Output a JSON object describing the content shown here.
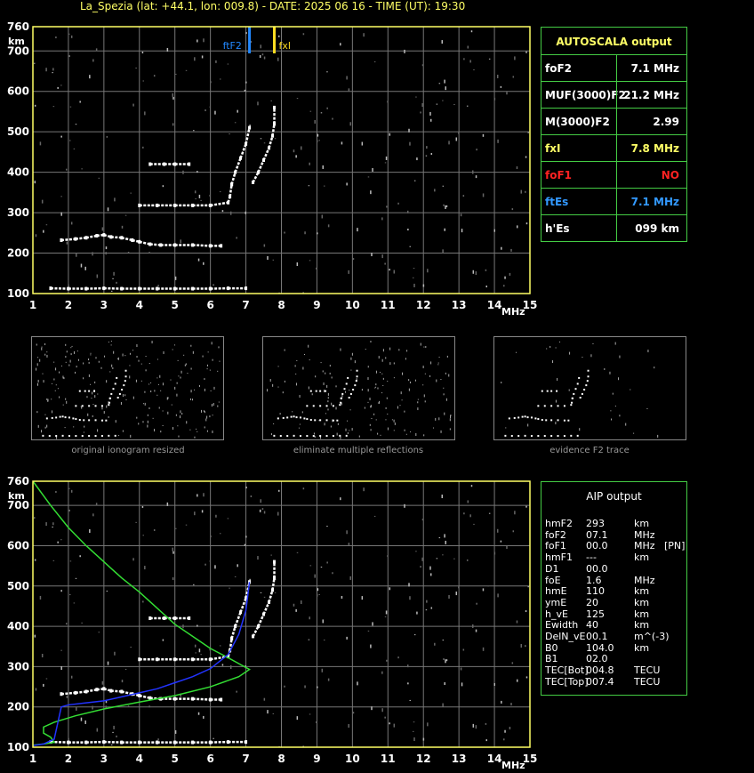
{
  "header": {
    "title": "La_Spezia (lat: +44.1, lon: 009.8) - DATE: 2025 06 16 - TIME (UT): 19:30"
  },
  "colors": {
    "axis": "#ffff66",
    "grid": "#777777",
    "trace": "#ffffff",
    "profile_green": "#33dd33",
    "profile_blue": "#2233ff",
    "fof2_marker": "#2288ff",
    "fxl_marker": "#ffdd22",
    "box": "#44cc44",
    "red": "#ff2222",
    "blue_text": "#3399ff",
    "yellow_text": "#ffff66"
  },
  "chart_data": [
    {
      "type": "scatter",
      "title": "",
      "xlabel": "MHz",
      "ylabel": "km",
      "xlim": [
        1,
        15
      ],
      "ylim": [
        100,
        760
      ],
      "x_ticks": [
        "1",
        "2",
        "3",
        "4",
        "5",
        "6",
        "7",
        "8",
        "9",
        "10",
        "11",
        "12",
        "13",
        "14",
        "15"
      ],
      "y_ticks": [
        "100",
        "200",
        "300",
        "400",
        "500",
        "600",
        "700",
        "760"
      ],
      "grid": true,
      "markers": [
        {
          "name": "foF2",
          "x": 7.1
        },
        {
          "name": "fxl",
          "x": 7.8
        }
      ],
      "series": [
        {
          "points": [
            [
              1.5,
              113
            ],
            [
              2.0,
              112
            ],
            [
              2.5,
              112
            ],
            [
              3.0,
              113
            ],
            [
              3.5,
              112
            ],
            [
              4.0,
              112
            ],
            [
              4.5,
              112
            ],
            [
              5.0,
              112
            ],
            [
              5.5,
              112
            ],
            [
              6.0,
              112
            ],
            [
              6.5,
              113
            ],
            [
              7.0,
              113
            ]
          ]
        },
        {
          "points": [
            [
              1.8,
              232
            ],
            [
              2.2,
              235
            ],
            [
              2.5,
              238
            ],
            [
              2.8,
              243
            ],
            [
              3.0,
              245
            ],
            [
              3.2,
              240
            ],
            [
              3.5,
              238
            ],
            [
              3.8,
              232
            ],
            [
              4.0,
              228
            ],
            [
              4.3,
              222
            ],
            [
              4.6,
              220
            ],
            [
              5.0,
              220
            ],
            [
              5.5,
              220
            ],
            [
              6.0,
              218
            ],
            [
              6.3,
              218
            ]
          ]
        },
        {
          "points": [
            [
              4.0,
              318
            ],
            [
              4.5,
              318
            ],
            [
              5.0,
              318
            ],
            [
              5.5,
              318
            ],
            [
              6.0,
              318
            ],
            [
              6.5,
              325
            ],
            [
              6.55,
              340
            ],
            [
              6.6,
              370
            ]
          ]
        },
        {
          "points": [
            [
              4.3,
              420
            ],
            [
              4.7,
              420
            ],
            [
              5.0,
              420
            ],
            [
              5.4,
              420
            ]
          ]
        },
        {
          "points": [
            [
              6.6,
              370
            ],
            [
              6.7,
              400
            ],
            [
              6.85,
              435
            ],
            [
              7.0,
              470
            ],
            [
              7.1,
              510
            ]
          ]
        },
        {
          "points": [
            [
              7.2,
              375
            ],
            [
              7.35,
              400
            ],
            [
              7.5,
              430
            ],
            [
              7.65,
              460
            ],
            [
              7.75,
              490
            ],
            [
              7.8,
              520
            ],
            [
              7.8,
              560
            ]
          ]
        }
      ]
    },
    {
      "type": "line",
      "title": "",
      "xlabel": "MHz",
      "ylabel": "km",
      "xlim": [
        1,
        15
      ],
      "ylim": [
        100,
        760
      ],
      "x_ticks": [
        "1",
        "2",
        "3",
        "4",
        "5",
        "6",
        "7",
        "8",
        "9",
        "10",
        "11",
        "12",
        "13",
        "14",
        "15"
      ],
      "y_ticks": [
        "100",
        "200",
        "300",
        "400",
        "500",
        "600",
        "700",
        "760"
      ],
      "grid": true,
      "series": [
        {
          "points": [
            [
              1.5,
              113
            ],
            [
              2.0,
              112
            ],
            [
              2.5,
              112
            ],
            [
              3.0,
              113
            ],
            [
              3.5,
              112
            ],
            [
              4.0,
              112
            ],
            [
              4.5,
              112
            ],
            [
              5.0,
              112
            ],
            [
              5.5,
              112
            ],
            [
              6.0,
              112
            ],
            [
              6.5,
              113
            ],
            [
              7.0,
              113
            ]
          ]
        },
        {
          "points": [
            [
              1.8,
              232
            ],
            [
              2.2,
              235
            ],
            [
              2.5,
              238
            ],
            [
              2.8,
              243
            ],
            [
              3.0,
              245
            ],
            [
              3.2,
              240
            ],
            [
              3.5,
              238
            ],
            [
              3.8,
              232
            ],
            [
              4.0,
              228
            ],
            [
              4.3,
              222
            ],
            [
              4.6,
              220
            ],
            [
              5.0,
              220
            ],
            [
              5.5,
              220
            ],
            [
              6.0,
              218
            ],
            [
              6.3,
              218
            ]
          ]
        },
        {
          "points": [
            [
              4.0,
              318
            ],
            [
              4.5,
              318
            ],
            [
              5.0,
              318
            ],
            [
              5.5,
              318
            ],
            [
              6.0,
              318
            ],
            [
              6.5,
              325
            ],
            [
              6.55,
              340
            ],
            [
              6.6,
              370
            ]
          ]
        },
        {
          "points": [
            [
              4.3,
              420
            ],
            [
              4.7,
              420
            ],
            [
              5.0,
              420
            ],
            [
              5.4,
              420
            ]
          ]
        },
        {
          "points": [
            [
              6.6,
              370
            ],
            [
              6.7,
              400
            ],
            [
              6.85,
              435
            ],
            [
              7.0,
              470
            ],
            [
              7.1,
              510
            ]
          ]
        },
        {
          "points": [
            [
              7.2,
              375
            ],
            [
              7.35,
              400
            ],
            [
              7.5,
              430
            ],
            [
              7.65,
              460
            ],
            [
              7.75,
              490
            ],
            [
              7.8,
              520
            ],
            [
              7.8,
              560
            ]
          ]
        },
        {
          "points": [
            [
              1.0,
              760
            ],
            [
              1.5,
              700
            ],
            [
              2.0,
              645
            ],
            [
              2.5,
              600
            ],
            [
              3.0,
              560
            ],
            [
              3.5,
              520
            ],
            [
              4.0,
              485
            ],
            [
              4.5,
              445
            ],
            [
              5.0,
              405
            ],
            [
              5.5,
              375
            ],
            [
              6.0,
              345
            ],
            [
              6.5,
              322
            ],
            [
              6.85,
              305
            ],
            [
              7.1,
              293
            ],
            [
              6.8,
              275
            ],
            [
              6.0,
              250
            ],
            [
              5.0,
              228
            ],
            [
              4.0,
              212
            ],
            [
              3.0,
              195
            ],
            [
              2.2,
              178
            ],
            [
              1.6,
              162
            ],
            [
              1.3,
              150
            ],
            [
              1.3,
              135
            ],
            [
              1.5,
              125
            ],
            [
              1.6,
              112
            ],
            [
              1.3,
              108
            ],
            [
              1.0,
              105
            ]
          ]
        },
        {
          "points": [
            [
              1.0,
              104
            ],
            [
              1.3,
              108
            ],
            [
              1.6,
              120
            ],
            [
              1.8,
              200
            ],
            [
              2.0,
              205
            ],
            [
              2.5,
              210
            ],
            [
              3.0,
              215
            ],
            [
              3.5,
              225
            ],
            [
              4.0,
              235
            ],
            [
              4.5,
              245
            ],
            [
              5.0,
              260
            ],
            [
              5.5,
              275
            ],
            [
              6.0,
              295
            ],
            [
              6.5,
              330
            ],
            [
              6.8,
              380
            ],
            [
              7.0,
              440
            ],
            [
              7.1,
              510
            ]
          ]
        }
      ]
    }
  ],
  "thumbnails": [
    {
      "caption": "original ionogram resized"
    },
    {
      "caption": "eliminate multiple reflections"
    },
    {
      "caption": "evidence F2 trace"
    }
  ],
  "autoscala": {
    "title": "AUTOSCALA output",
    "rows": [
      {
        "label": "foF2",
        "value": "7.1 MHz",
        "color": "#ffffff"
      },
      {
        "label": "MUF(3000)F2",
        "value": "21.2 MHz",
        "color": "#ffffff"
      },
      {
        "label": "M(3000)F2",
        "value": "2.99",
        "color": "#ffffff"
      },
      {
        "label": "fxI",
        "value": "7.8 MHz",
        "color": "#ffff66"
      },
      {
        "label": "foF1",
        "value": "NO",
        "color": "#ff2222"
      },
      {
        "label": "ftEs",
        "value": "7.1 MHz",
        "color": "#3399ff"
      },
      {
        "label": "h'Es",
        "value": "099    km",
        "color": "#ffffff"
      }
    ]
  },
  "aip": {
    "title": "AIP output",
    "rows": [
      [
        "hmF2",
        "293",
        "km",
        ""
      ],
      [
        "foF2",
        "07.1",
        "MHz",
        ""
      ],
      [
        "foF1",
        "00.0",
        "MHz",
        "[PN]"
      ],
      [
        "hmF1",
        "---",
        "km",
        ""
      ],
      [
        "D1",
        "00.0",
        "",
        ""
      ],
      [
        "foE",
        "1.6",
        "MHz",
        ""
      ],
      [
        "hmE",
        "110",
        "km",
        ""
      ],
      [
        "ymE",
        "20",
        "km",
        ""
      ],
      [
        "h_vE",
        "125",
        "km",
        ""
      ],
      [
        "Ewidth",
        "40",
        "km",
        ""
      ],
      [
        "DelN_vE",
        "00.1",
        "m^(-3)",
        ""
      ],
      [
        "B0",
        "104.0",
        "km",
        ""
      ],
      [
        "B1",
        "02.0",
        "",
        ""
      ],
      [
        "TEC[Bot]",
        "004.8",
        "TECU",
        ""
      ],
      [
        "TEC[Top]",
        "007.4",
        "TECU",
        ""
      ]
    ]
  }
}
